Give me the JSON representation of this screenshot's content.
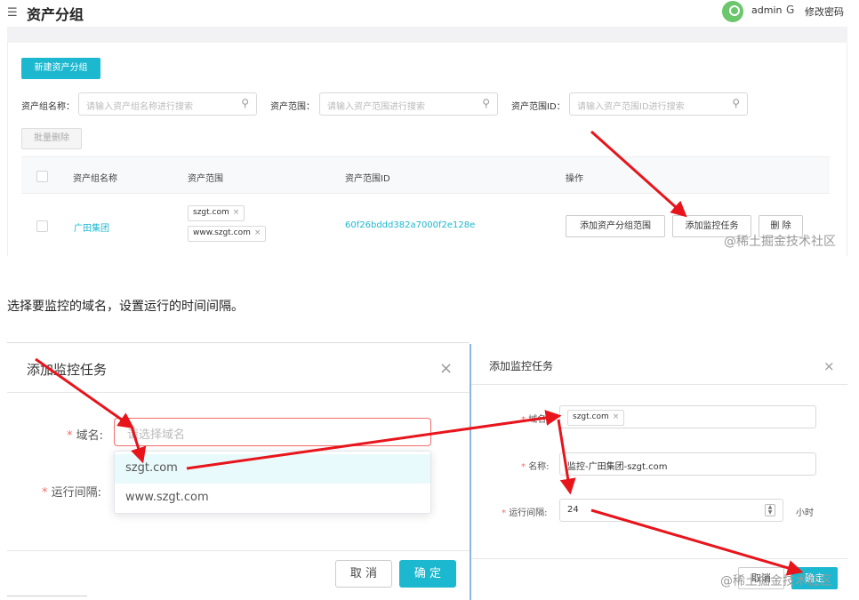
{
  "header": {
    "menu_icon": "menu-icon",
    "title": "资产分组",
    "avatar_icon": "user-avatar-icon",
    "username": "admin",
    "logout_icon_glyph": "G",
    "change_password": "修改密码"
  },
  "toolbar": {
    "new_group_button": "新建资产分组",
    "filters": [
      {
        "label": "资产组名称：",
        "placeholder": "请输入资产组名称进行搜索"
      },
      {
        "label": "资产范围：",
        "placeholder": "请输入资产范围进行搜索"
      },
      {
        "label": "资产范围ID：",
        "placeholder": "请输入资产范围ID进行搜索"
      }
    ],
    "batch_delete_button": "批量删除"
  },
  "table": {
    "columns": [
      "资产组名称",
      "资产范围",
      "资产范围ID",
      "操作"
    ],
    "rows": [
      {
        "name": "广田集团",
        "scopes": [
          "szgt.com",
          "www.szgt.com"
        ],
        "scope_id": "60f26bddd382a7000f2e128e",
        "actions": [
          "添加资产分组范围",
          "添加监控任务",
          "删 除"
        ]
      }
    ]
  },
  "watermark": "@稀土掘金技术社区",
  "caption": "选择要监控的域名，设置运行的时间间隔。",
  "dialog_left": {
    "title": "添加监控任务",
    "close_glyph": "×",
    "domain_label": "域名:",
    "domain_placeholder": "请选择域名",
    "interval_label": "运行间隔:",
    "options": [
      "szgt.com",
      "www.szgt.com"
    ],
    "cancel": "取 消",
    "confirm": "确 定"
  },
  "dialog_right": {
    "title": "添加监控任务",
    "close_glyph": "×",
    "domain_label": "域名:",
    "domain_tag": "szgt.com",
    "name_label": "名称:",
    "name_value": "监控-广田集团-szgt.com",
    "interval_label": "运行间隔:",
    "interval_value": "24",
    "interval_unit": "小时",
    "cancel": "取消",
    "confirm": "确定"
  },
  "colors": {
    "accent": "#1cb8cf",
    "error": "#f56c6c",
    "arrow": "#e8141b"
  }
}
